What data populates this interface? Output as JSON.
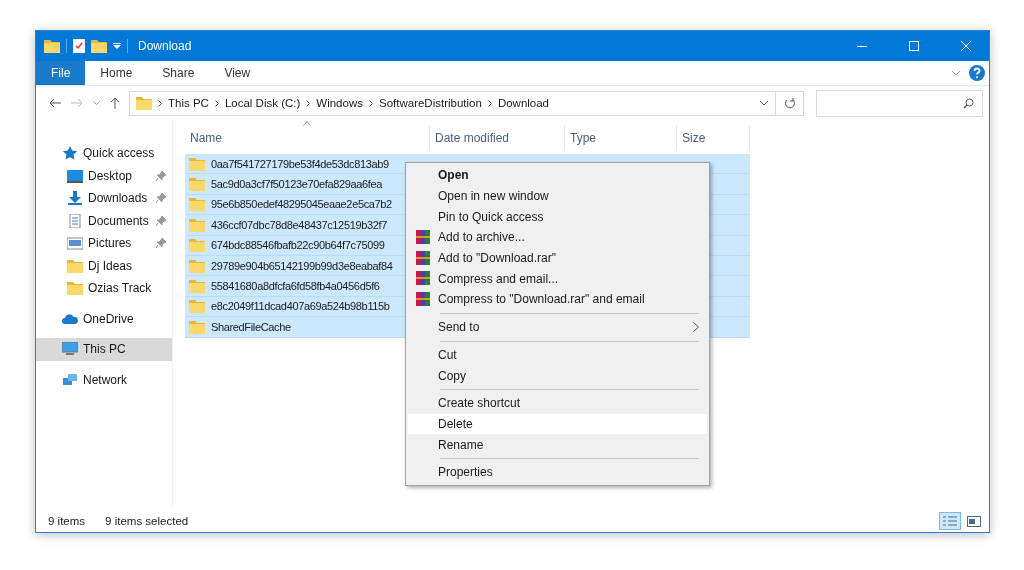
{
  "window": {
    "title": "Download"
  },
  "ribbon": {
    "tabs": [
      {
        "label": "File",
        "kind": "file"
      },
      {
        "label": "Home",
        "kind": "tab"
      },
      {
        "label": "Share",
        "kind": "tab"
      },
      {
        "label": "View",
        "kind": "tab"
      }
    ]
  },
  "address_bar": {
    "breadcrumbs": [
      "This PC",
      "Local Disk (C:)",
      "Windows",
      "SoftwareDistribution",
      "Download"
    ]
  },
  "nav_pane": {
    "items": [
      {
        "label": "Quick access",
        "kind": "star",
        "selected": false,
        "children": [
          {
            "label": "Desktop",
            "kind": "desktop",
            "pinned": true,
            "selected": false
          },
          {
            "label": "Downloads",
            "kind": "download",
            "pinned": true,
            "selected": false
          },
          {
            "label": "Documents",
            "kind": "document",
            "pinned": true,
            "selected": false
          },
          {
            "label": "Pictures",
            "kind": "picture",
            "pinned": true,
            "selected": false
          },
          {
            "label": "Dj Ideas",
            "kind": "folder",
            "pinned": false,
            "selected": false
          },
          {
            "label": "Ozias Track",
            "kind": "folder",
            "pinned": false,
            "selected": false
          }
        ]
      },
      {
        "label": "OneDrive",
        "kind": "cloud",
        "selected": false
      },
      {
        "label": "This PC",
        "kind": "computer",
        "selected": true
      },
      {
        "label": "Network",
        "kind": "network",
        "selected": false
      }
    ]
  },
  "table": {
    "columns": [
      "Name",
      "Date modified",
      "Type",
      "Size"
    ],
    "rows": [
      {
        "name": "0aa7f541727179be53f4de53dc813ab9",
        "selected": true
      },
      {
        "name": "5ac9d0a3cf7f50123e70efa829aa6fea",
        "selected": true
      },
      {
        "name": "95e6b850edef48295045eaae2e5ca7b2",
        "selected": true
      },
      {
        "name": "436ccf07dbc78d8e48437c12519b32f7",
        "selected": true
      },
      {
        "name": "674bdc88546fbafb22c90b64f7c75099",
        "selected": true
      },
      {
        "name": "29789e904b65142199b99d3e8eabaf84",
        "selected": true
      },
      {
        "name": "55841680a8dfcfa6fd58fb4a0456d5f6",
        "selected": true
      },
      {
        "name": "e8c2049f11dcad407a69a524b98b115b",
        "selected": true
      },
      {
        "name": "SharedFileCache",
        "selected": true
      }
    ]
  },
  "context_menu": {
    "groups": [
      [
        {
          "label": "Open",
          "kind": "plain",
          "default": true,
          "highlighted": false
        },
        {
          "label": "Open in new window",
          "kind": "plain",
          "default": false,
          "highlighted": false
        },
        {
          "label": "Pin to Quick access",
          "kind": "plain",
          "default": false,
          "highlighted": false
        },
        {
          "label": "Add to archive...",
          "kind": "archive",
          "default": false,
          "highlighted": false
        },
        {
          "label": "Add to \"Download.rar\"",
          "kind": "archive",
          "default": false,
          "highlighted": false
        },
        {
          "label": "Compress and email...",
          "kind": "archive",
          "default": false,
          "highlighted": false
        },
        {
          "label": "Compress to \"Download.rar\" and email",
          "kind": "archive",
          "default": false,
          "highlighted": false
        }
      ],
      [
        {
          "label": "Send to",
          "kind": "submenu",
          "default": false,
          "highlighted": false
        }
      ],
      [
        {
          "label": "Cut",
          "kind": "plain",
          "default": false,
          "highlighted": false
        },
        {
          "label": "Copy",
          "kind": "plain",
          "default": false,
          "highlighted": false
        }
      ],
      [
        {
          "label": "Create shortcut",
          "kind": "plain",
          "default": false,
          "highlighted": false
        },
        {
          "label": "Delete",
          "kind": "plain",
          "default": false,
          "highlighted": true
        },
        {
          "label": "Rename",
          "kind": "plain",
          "default": false,
          "highlighted": false
        }
      ],
      [
        {
          "label": "Properties",
          "kind": "plain",
          "default": false,
          "highlighted": false
        }
      ]
    ]
  },
  "status_bar": {
    "item_count": "9 items",
    "selection": "9 items selected",
    "view_buttons": [
      {
        "kind": "details",
        "selected": true
      },
      {
        "kind": "large-icons",
        "selected": false
      }
    ]
  }
}
